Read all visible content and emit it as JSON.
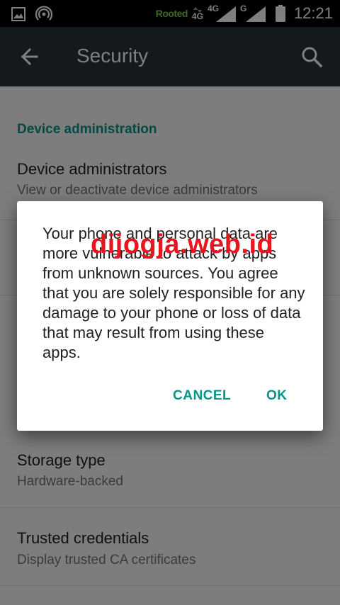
{
  "status_bar": {
    "rooted_label": "Rooted",
    "network_4g_small": "4G",
    "network_4g": "4G",
    "network_g": "G",
    "time": "12:21",
    "icons": [
      "image-icon",
      "hotspot-icon",
      "data-arrows-icon",
      "signal-icon",
      "signal-icon",
      "battery-icon"
    ]
  },
  "toolbar": {
    "title": "Security",
    "back_icon": "arrow-back-icon",
    "search_icon": "search-icon",
    "background": "#263238"
  },
  "settings": {
    "section_header": "Device administration",
    "items": [
      {
        "title": "Device administrators",
        "summary": "View or deactivate device administrators"
      },
      {
        "title": "Storage type",
        "summary": "Hardware-backed"
      },
      {
        "title": "Trusted credentials",
        "summary": "Display trusted CA certificates"
      }
    ]
  },
  "dialog": {
    "message": "Your phone and personal data are more vulnerable to attack by apps from unknown sources. You agree that you are solely responsible for any damage to your phone or loss of data that may result from using these apps.",
    "cancel_label": "CANCEL",
    "ok_label": "OK"
  },
  "watermark": "dijogja.web.id",
  "colors": {
    "accent": "#009688",
    "watermark": "#e8141e",
    "rooted": "#7ad13f"
  }
}
